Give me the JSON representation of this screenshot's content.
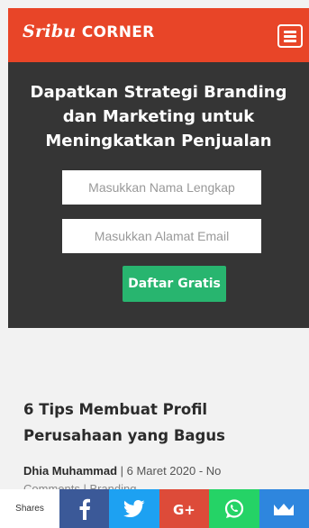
{
  "header": {
    "logo_script": "Sribu",
    "logo_text": "CORNER",
    "menu_icon": "hamburger-icon"
  },
  "hero": {
    "title_lines": [
      "Dapatkan Strategi Branding",
      "dan Marketing untuk",
      "Meningkatkan Penjualan"
    ],
    "name_placeholder": "Masukkan Nama Lengkap",
    "email_placeholder": "Masukkan Alamat Email",
    "cta_label": "Daftar Gratis"
  },
  "article": {
    "title": "6 Tips Membuat Profil Perusahaan yang Bagus",
    "author": "Dhia Muhammad",
    "meta_rest": " | 6 Maret 2020 - No",
    "meta_line2": "Comments | Branding"
  },
  "share": {
    "label": "Shares",
    "buttons": [
      {
        "name": "facebook-icon",
        "color": "#3b5998"
      },
      {
        "name": "twitter-icon",
        "color": "#1da1f2"
      },
      {
        "name": "google-plus-icon",
        "color": "#dd4b39"
      },
      {
        "name": "whatsapp-icon",
        "color": "#25d366"
      },
      {
        "name": "sumo-crown-icon",
        "color": "#2e86de"
      }
    ]
  },
  "colors": {
    "header": "#e84528",
    "hero_bg": "#353535",
    "cta": "#28b56f",
    "page_bg": "#f2f2f2"
  }
}
